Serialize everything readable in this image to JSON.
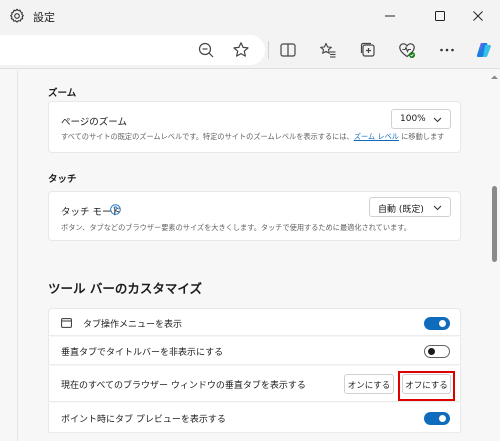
{
  "window": {
    "title": "設定",
    "minimize_icon": "minimize-icon",
    "maximize_icon": "maximize-icon",
    "close_icon": "close-icon"
  },
  "toolbar": {
    "icons": [
      "zoom-out-icon",
      "favorite-star-icon",
      "split-screen-icon",
      "favorites-list-icon",
      "collections-icon",
      "browser-essentials-icon",
      "more-icon",
      "copilot-icon"
    ]
  },
  "zoom_section": {
    "heading": "ズーム",
    "page_zoom_label": "ページのズーム",
    "page_zoom_desc_before": "すべてのサイトの既定のズームレベルです。特定のサイトのズームレベルを表示するには、",
    "page_zoom_desc_link": "ズーム レベル",
    "page_zoom_desc_after": " に移動します",
    "page_zoom_value": "100%"
  },
  "touch_section": {
    "heading": "タッチ",
    "touch_mode_label": "タッチ モード",
    "touch_mode_desc": "ボタン、タブなどのブラウザー要素のサイズを大きくします。タッチで使用するために最適化されています。",
    "touch_mode_value": "自動 (既定)"
  },
  "toolbar_section": {
    "heading": "ツール バーのカスタマイズ",
    "rows": [
      {
        "label": "タブ操作メニューを表示",
        "state": "on"
      },
      {
        "label": "垂直タブでタイトルバーを非表示にする",
        "state": "off"
      },
      {
        "label": "現在のすべてのブラウザー ウィンドウの垂直タブを表示する",
        "on_button": "オンにする",
        "off_button": "オフにする"
      },
      {
        "label": "ポイント時にタブ プレビューを表示する",
        "state": "on"
      }
    ]
  },
  "colors": {
    "accent": "#0f6cbd",
    "highlight": "#e00000"
  }
}
